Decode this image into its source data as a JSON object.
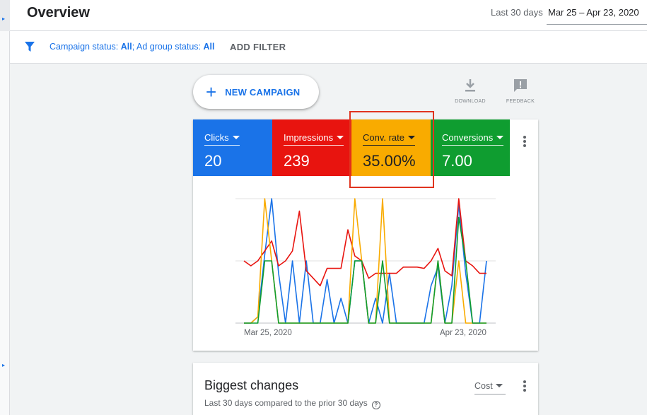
{
  "header": {
    "title": "Overview",
    "range_label": "Last 30 days",
    "range_value": "Mar 25 – Apr 23, 2020"
  },
  "filters": {
    "campaign_status_label": "Campaign status: ",
    "campaign_status_value": "All",
    "separator": "; ",
    "ad_group_status_label": "Ad group status: ",
    "ad_group_status_value": "All",
    "add_filter": "ADD FILTER"
  },
  "actions": {
    "new_campaign": "NEW CAMPAIGN",
    "download": "DOWNLOAD",
    "feedback": "FEEDBACK"
  },
  "metrics": [
    {
      "label": "Clicks",
      "value": "20",
      "color": "#1a73e8"
    },
    {
      "label": "Impressions",
      "value": "239",
      "color": "#e8140f"
    },
    {
      "label": "Conv. rate",
      "value": "35.00%",
      "color": "#f9ab00"
    },
    {
      "label": "Conversions",
      "value": "7.00",
      "color": "#0f9d30"
    }
  ],
  "chart_data": {
    "type": "line",
    "x_start_label": "Mar 25, 2020",
    "x_end_label": "Apr 23, 2020",
    "grid": true,
    "ylim": [
      0,
      1
    ],
    "series": [
      {
        "name": "Clicks",
        "color": "#1a73e8",
        "values": [
          0,
          0,
          0.05,
          0.55,
          1,
          0.4,
          0,
          0.5,
          0,
          0.5,
          0,
          0,
          0.35,
          0,
          0.2,
          0,
          0.5,
          0.5,
          0,
          0.2,
          0,
          0.4,
          0,
          0,
          0,
          0,
          0,
          0.3,
          0.45,
          0,
          0.3,
          0.95,
          0.4,
          0,
          0,
          0.5
        ]
      },
      {
        "name": "Impressions",
        "color": "#e8140f",
        "values": [
          0.5,
          0.46,
          0.5,
          0.58,
          0.66,
          0.46,
          0.5,
          0.58,
          0.9,
          0.42,
          0.36,
          0.3,
          0.44,
          0.44,
          0.44,
          0.75,
          0.54,
          0.5,
          0.36,
          0.4,
          0.4,
          0.4,
          0.4,
          0.45,
          0.45,
          0.45,
          0.44,
          0.5,
          0.6,
          0.42,
          0.38,
          1,
          0.5,
          0.46,
          0.4,
          0.4
        ]
      },
      {
        "name": "Conv. rate",
        "color": "#f9ab00",
        "values": [
          0,
          0,
          0.05,
          1,
          0.5,
          0,
          0,
          0,
          0,
          0,
          0,
          0,
          0,
          0,
          0,
          0,
          1,
          0.5,
          0,
          0,
          1,
          0,
          0,
          0,
          0,
          0,
          0,
          0,
          0.5,
          0,
          0,
          0.5,
          0,
          0,
          0,
          0
        ]
      },
      {
        "name": "Conversions",
        "color": "#0f9d30",
        "values": [
          0,
          0,
          0,
          0.5,
          0.5,
          0,
          0,
          0,
          0,
          0,
          0,
          0,
          0,
          0,
          0,
          0,
          0.5,
          0.5,
          0,
          0,
          0.5,
          0,
          0,
          0,
          0,
          0,
          0,
          0,
          0.5,
          0,
          0,
          0.85,
          0.5,
          0,
          0,
          0
        ]
      }
    ]
  },
  "biggest_changes": {
    "title": "Biggest changes",
    "subtitle": "Last 30 days compared to the prior 30 days",
    "help": "?",
    "sort": "Cost"
  }
}
